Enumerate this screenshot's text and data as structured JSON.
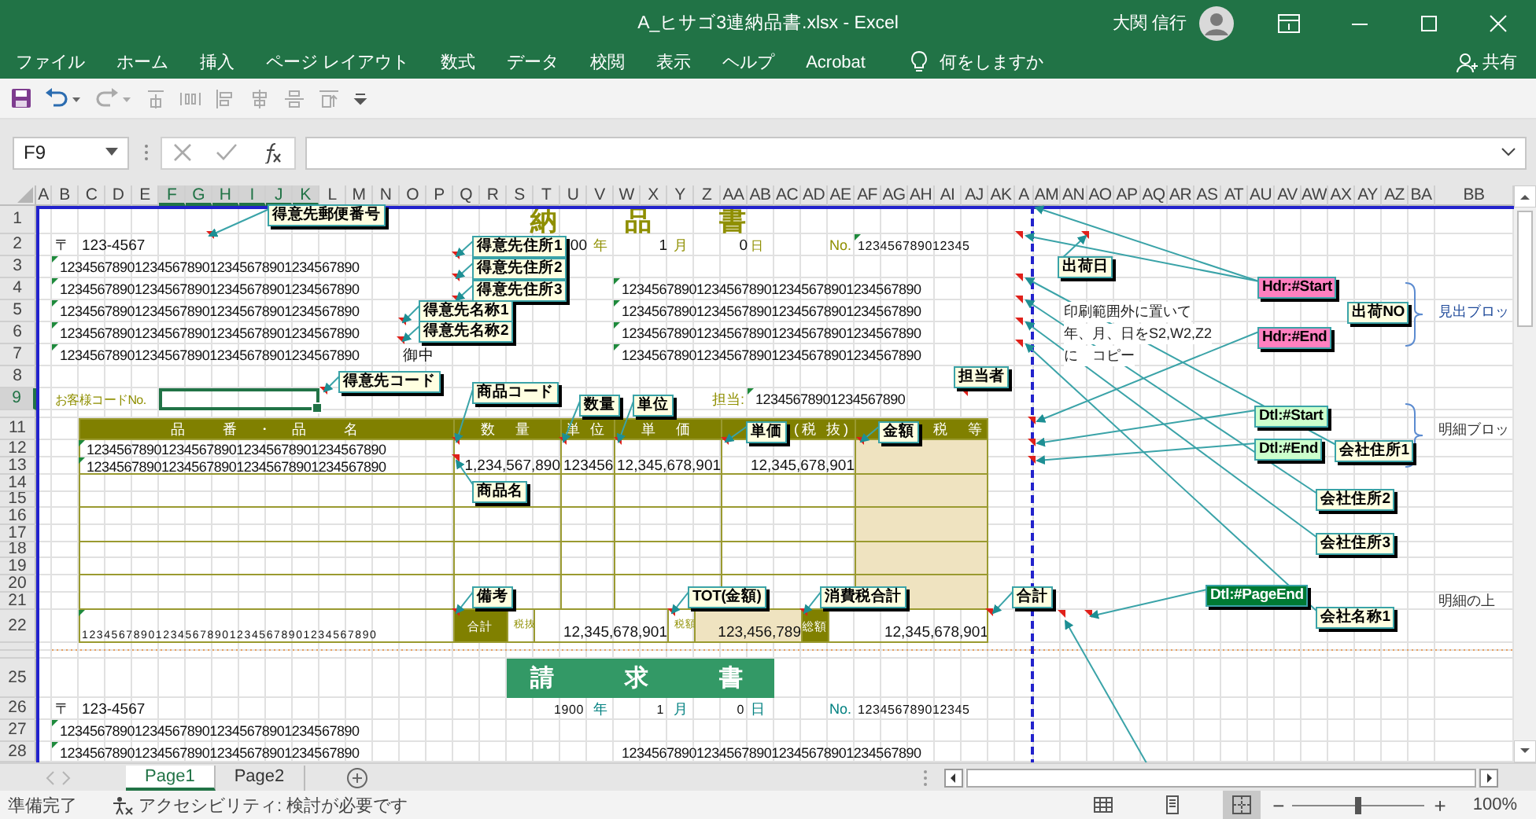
{
  "window": {
    "title": "A_ヒサゴ3連納品書.xlsx  -  Excel",
    "user": "大関 信行"
  },
  "ribbon_tabs": [
    {
      "label": "ファイル"
    },
    {
      "label": "ホーム"
    },
    {
      "label": "挿入"
    },
    {
      "label": "ページ レイアウト"
    },
    {
      "label": "数式"
    },
    {
      "label": "データ"
    },
    {
      "label": "校閲"
    },
    {
      "label": "表示"
    },
    {
      "label": "ヘルプ"
    },
    {
      "label": "Acrobat"
    }
  ],
  "tell_me": "何をしますか",
  "share": "共有",
  "name_box": "F9",
  "sheet": {
    "columns": [
      {
        "label": "A",
        "selected": false
      },
      {
        "label": "B",
        "selected": false
      },
      {
        "label": "C",
        "selected": false
      },
      {
        "label": "D",
        "selected": false
      },
      {
        "label": "E",
        "selected": false
      },
      {
        "label": "F",
        "selected": true
      },
      {
        "label": "G",
        "selected": true
      },
      {
        "label": "H",
        "selected": true
      },
      {
        "label": "I",
        "selected": true
      },
      {
        "label": "J",
        "selected": true
      },
      {
        "label": "K",
        "selected": true
      },
      {
        "label": "L",
        "selected": false
      },
      {
        "label": "M",
        "selected": false
      },
      {
        "label": "N",
        "selected": false
      },
      {
        "label": "O",
        "selected": false
      },
      {
        "label": "P",
        "selected": false
      },
      {
        "label": "Q",
        "selected": false
      },
      {
        "label": "R",
        "selected": false
      },
      {
        "label": "S",
        "selected": false
      },
      {
        "label": "T",
        "selected": false
      },
      {
        "label": "U",
        "selected": false
      },
      {
        "label": "V",
        "selected": false
      },
      {
        "label": "W",
        "selected": false
      },
      {
        "label": "X",
        "selected": false
      },
      {
        "label": "Y",
        "selected": false
      },
      {
        "label": "Z",
        "selected": false
      },
      {
        "label": "AA",
        "selected": false
      },
      {
        "label": "AB",
        "selected": false
      },
      {
        "label": "AC",
        "selected": false
      },
      {
        "label": "AD",
        "selected": false
      },
      {
        "label": "AE",
        "selected": false
      },
      {
        "label": "AF",
        "selected": false
      },
      {
        "label": "AG",
        "selected": false
      },
      {
        "label": "AH",
        "selected": false
      },
      {
        "label": "AI",
        "selected": false
      },
      {
        "label": "AJ",
        "selected": false
      },
      {
        "label": "AK",
        "selected": false
      },
      {
        "label": "A",
        "selected": false
      },
      {
        "label": "AM",
        "selected": false
      },
      {
        "label": "AN",
        "selected": false
      },
      {
        "label": "AO",
        "selected": false
      },
      {
        "label": "AP",
        "selected": false
      },
      {
        "label": "AQ",
        "selected": false
      },
      {
        "label": "AR",
        "selected": false
      },
      {
        "label": "AS",
        "selected": false
      },
      {
        "label": "AT",
        "selected": false
      },
      {
        "label": "AU",
        "selected": false
      },
      {
        "label": "AV",
        "selected": false
      },
      {
        "label": "AW",
        "selected": false
      },
      {
        "label": "AX",
        "selected": false
      },
      {
        "label": "AY",
        "selected": false
      },
      {
        "label": "AZ",
        "selected": false
      },
      {
        "label": "BA",
        "selected": false
      },
      {
        "label": "BB",
        "selected": false
      }
    ],
    "rows": [
      {
        "label": "1",
        "selected": false
      },
      {
        "label": "2",
        "selected": false
      },
      {
        "label": "3",
        "selected": false
      },
      {
        "label": "4",
        "selected": false
      },
      {
        "label": "5",
        "selected": false
      },
      {
        "label": "6",
        "selected": false
      },
      {
        "label": "7",
        "selected": false
      },
      {
        "label": "8",
        "selected": false
      },
      {
        "label": "9",
        "selected": true
      },
      {
        "selected": false
      },
      {
        "label": "11",
        "selected": false
      },
      {
        "label": "12",
        "selected": false
      },
      {
        "label": "13",
        "selected": false
      },
      {
        "label": "14",
        "selected": false
      },
      {
        "label": "15",
        "selected": false
      },
      {
        "label": "16",
        "selected": false
      },
      {
        "label": "17",
        "selected": false
      },
      {
        "label": "18",
        "selected": false
      },
      {
        "label": "19",
        "selected": false
      },
      {
        "label": "20",
        "selected": false
      },
      {
        "label": "21",
        "selected": false
      },
      {
        "label": "22",
        "selected": false
      },
      {
        "selected": false
      },
      {
        "selected": false
      },
      {
        "label": "25",
        "selected": false
      },
      {
        "label": "26",
        "selected": false
      },
      {
        "label": "27",
        "selected": false
      },
      {
        "label": "28",
        "selected": false
      }
    ],
    "cells": [
      {
        "kind": "title",
        "text": "納　　品　　書"
      },
      {
        "kind": "value",
        "text": "〒"
      },
      {
        "kind": "value",
        "text": "123-4567"
      },
      {
        "kind": "value",
        "text": "00"
      },
      {
        "kind": "label",
        "text": "年"
      },
      {
        "kind": "value",
        "text": "1"
      },
      {
        "kind": "label",
        "text": "月"
      },
      {
        "kind": "value",
        "text": "0"
      },
      {
        "kind": "label",
        "text": "日"
      },
      {
        "kind": "label",
        "text": "No."
      },
      {
        "kind": "small",
        "text": "123456789012345"
      },
      {
        "kind": "long",
        "text": "1234567890123456789012345678901234567890"
      },
      {
        "kind": "long",
        "text": "1234567890123456789012345678901234567890"
      },
      {
        "kind": "long",
        "text": "1234567890123456789012345678901234567890"
      },
      {
        "kind": "long",
        "text": "1234567890123456789012345678901234567890"
      },
      {
        "kind": "long",
        "text": "1234567890123456789012345678901234567890"
      },
      {
        "kind": "value",
        "text": "御中"
      },
      {
        "kind": "long",
        "text": "1234567890123456789012345678901234567890"
      },
      {
        "kind": "long",
        "text": "1234567890123456789012345678901234567890"
      },
      {
        "kind": "long",
        "text": "1234567890123456789012345678901234567890"
      },
      {
        "kind": "long",
        "text": "1234567890123456789012345678901234567890"
      },
      {
        "kind": "label",
        "text": "お客様コードNo."
      },
      {
        "kind": "label",
        "text": "担当:"
      },
      {
        "kind": "long",
        "text": "12345678901234567890"
      },
      {
        "kind": "header",
        "text": "品　　番　・　品　　名"
      },
      {
        "kind": "header",
        "text": "数　量"
      },
      {
        "kind": "header",
        "text": "単 位"
      },
      {
        "kind": "header",
        "text": "単　価"
      },
      {
        "kind": "header",
        "text": "(税 抜)"
      },
      {
        "kind": "header",
        "text": "税　等"
      },
      {
        "kind": "long",
        "text": "1234567890123456789012345678901234567890"
      },
      {
        "kind": "long",
        "text": "1234567890123456789012345678901234567890"
      },
      {
        "kind": "value",
        "text": "1,234,567,890"
      },
      {
        "kind": "value",
        "text": "123456"
      },
      {
        "kind": "value",
        "text": "12,345,678,901"
      },
      {
        "kind": "value",
        "text": "12,345,678,901"
      },
      {
        "kind": "wide",
        "text": "1234567890123456789012345678901234567890"
      },
      {
        "kind": "total_label",
        "text": "合計"
      },
      {
        "kind": "tax_label",
        "text": "税抜"
      },
      {
        "kind": "value",
        "text": "12,345,678,901"
      },
      {
        "kind": "tax_label",
        "text": "税額"
      },
      {
        "kind": "value",
        "text": "123,456,789"
      },
      {
        "kind": "total_label",
        "text": "総額"
      },
      {
        "kind": "value",
        "text": "12,345,678,901"
      },
      {
        "kind": "banner",
        "text": "請　　求　　書"
      },
      {
        "kind": "value",
        "text": "〒"
      },
      {
        "kind": "value",
        "text": "123-4567"
      },
      {
        "kind": "small",
        "text": "1900"
      },
      {
        "kind": "teal",
        "text": "年"
      },
      {
        "kind": "small",
        "text": "1"
      },
      {
        "kind": "teal",
        "text": "月"
      },
      {
        "kind": "small",
        "text": "0"
      },
      {
        "kind": "teal",
        "text": "日"
      },
      {
        "kind": "teal",
        "text": "No."
      },
      {
        "kind": "small",
        "text": "123456789012345"
      },
      {
        "kind": "long",
        "text": "1234567890123456789012345678901234567890"
      },
      {
        "kind": "long",
        "text": "1234567890123456789012345678901234567890"
      },
      {
        "kind": "long",
        "text": "1234567890123456789012345678901234567890"
      },
      {
        "kind": "note",
        "text": "印刷範囲外に置いて"
      },
      {
        "kind": "note",
        "text": "年、月、日をS2,W2,Z2"
      },
      {
        "kind": "note",
        "text": "に　コピー"
      },
      {
        "kind": "block_blue",
        "text": "見出ブロッ"
      },
      {
        "kind": "block",
        "text": "明細ブロッ"
      },
      {
        "kind": "block",
        "text": "明細の上"
      }
    ],
    "callouts": [
      {
        "text": "得意先郵便番号",
        "kind": "note"
      },
      {
        "text": "得意先住所1",
        "kind": "note"
      },
      {
        "text": "得意先住所2",
        "kind": "note"
      },
      {
        "text": "得意先住所3",
        "kind": "note"
      },
      {
        "text": "得意先名称1",
        "kind": "note"
      },
      {
        "text": "得意先名称2",
        "kind": "note"
      },
      {
        "text": "得意先コード",
        "kind": "note"
      },
      {
        "text": "商品コード",
        "kind": "note"
      },
      {
        "text": "数量",
        "kind": "note"
      },
      {
        "text": "単位",
        "kind": "note"
      },
      {
        "text": "担当者",
        "kind": "note"
      },
      {
        "text": "単価",
        "kind": "note"
      },
      {
        "text": "金額",
        "kind": "note"
      },
      {
        "text": "商品名",
        "kind": "note"
      },
      {
        "text": "備考",
        "kind": "note"
      },
      {
        "text": "TOT(金額)",
        "kind": "note"
      },
      {
        "text": "消費税合計",
        "kind": "note"
      },
      {
        "text": "合計",
        "kind": "note"
      },
      {
        "text": "出荷日",
        "kind": "note"
      },
      {
        "text": "Hdr:#Start",
        "kind": "header_marker"
      },
      {
        "text": "出荷NO",
        "kind": "note"
      },
      {
        "text": "Hdr:#End",
        "kind": "header_marker"
      },
      {
        "text": "Dtl:#Start",
        "kind": "detail_marker"
      },
      {
        "text": "Dtl:#End",
        "kind": "detail_marker"
      },
      {
        "text": "会社住所1",
        "kind": "note"
      },
      {
        "text": "会社住所2",
        "kind": "note"
      },
      {
        "text": "会社住所3",
        "kind": "note"
      },
      {
        "text": "Dtl:#PageEnd",
        "kind": "page_end"
      },
      {
        "text": "会社名称1",
        "kind": "note"
      }
    ]
  },
  "sheet_tabs": [
    {
      "label": "Page1",
      "selected": true
    },
    {
      "label": "Page2",
      "selected": false
    }
  ],
  "status_bar": {
    "status": "準備完了",
    "accessibility": "アクセシビリティ: 検討が必要です",
    "views": [
      {
        "kind": "normal",
        "selected": false
      },
      {
        "kind": "page_layout",
        "selected": false
      },
      {
        "kind": "page_break",
        "selected": true
      }
    ],
    "zoom_out": "−",
    "zoom_in": "+",
    "zoom": {
      "level": 0.5,
      "reading": "100%"
    }
  }
}
